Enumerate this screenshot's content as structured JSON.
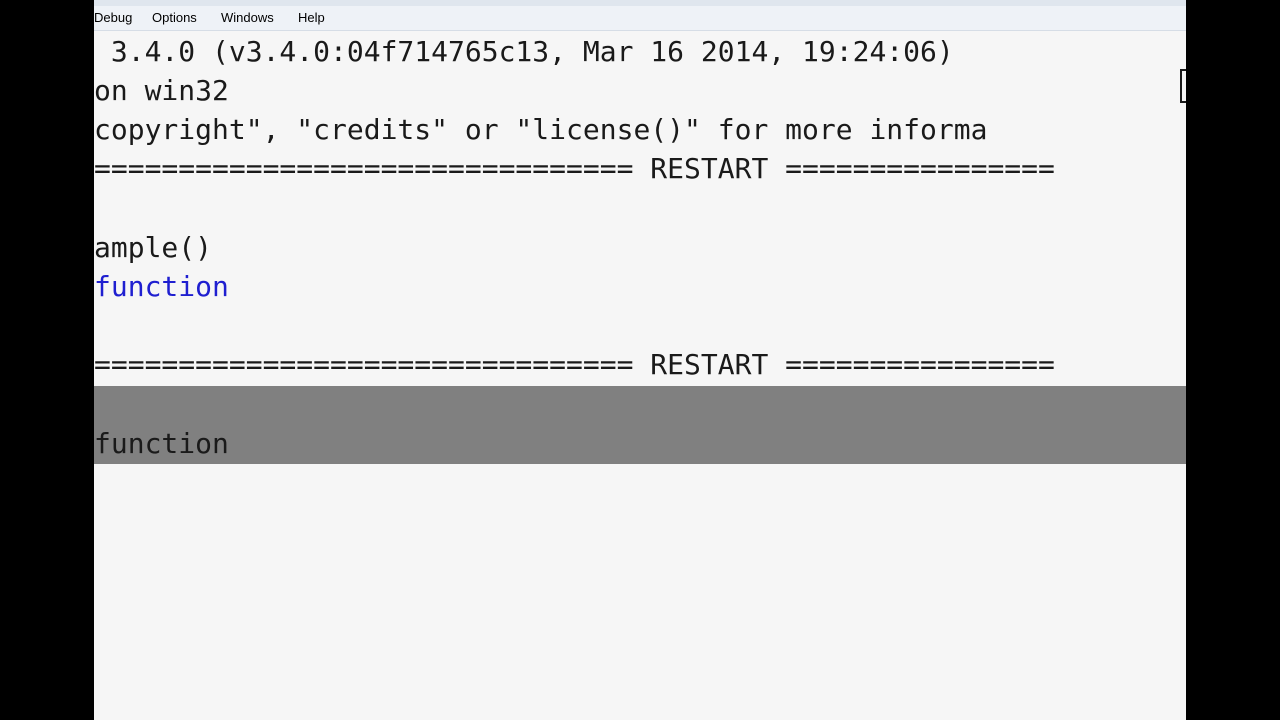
{
  "menu": {
    "debug": "Debug",
    "options": "Options",
    "windows": "Windows",
    "help": "Help"
  },
  "shell": {
    "version_line": " 3.4.0 (v3.4.0:04f714765c13, Mar 16 2014, 19:24:06) ",
    "platform_line": "on win32",
    "copyright_line": "copyright\", \"credits\" or \"license()\" for more informa",
    "restart_line_1": "================================ RESTART ================",
    "call_line": "ample()",
    "output_1": "function",
    "restart_line_2": "================================ RESTART ================",
    "output_2": "function"
  },
  "colors": {
    "background": "#000000",
    "shell_bg": "#f6f6f6",
    "output_blue": "#1f1fd0",
    "highlight_band": "#808080"
  }
}
